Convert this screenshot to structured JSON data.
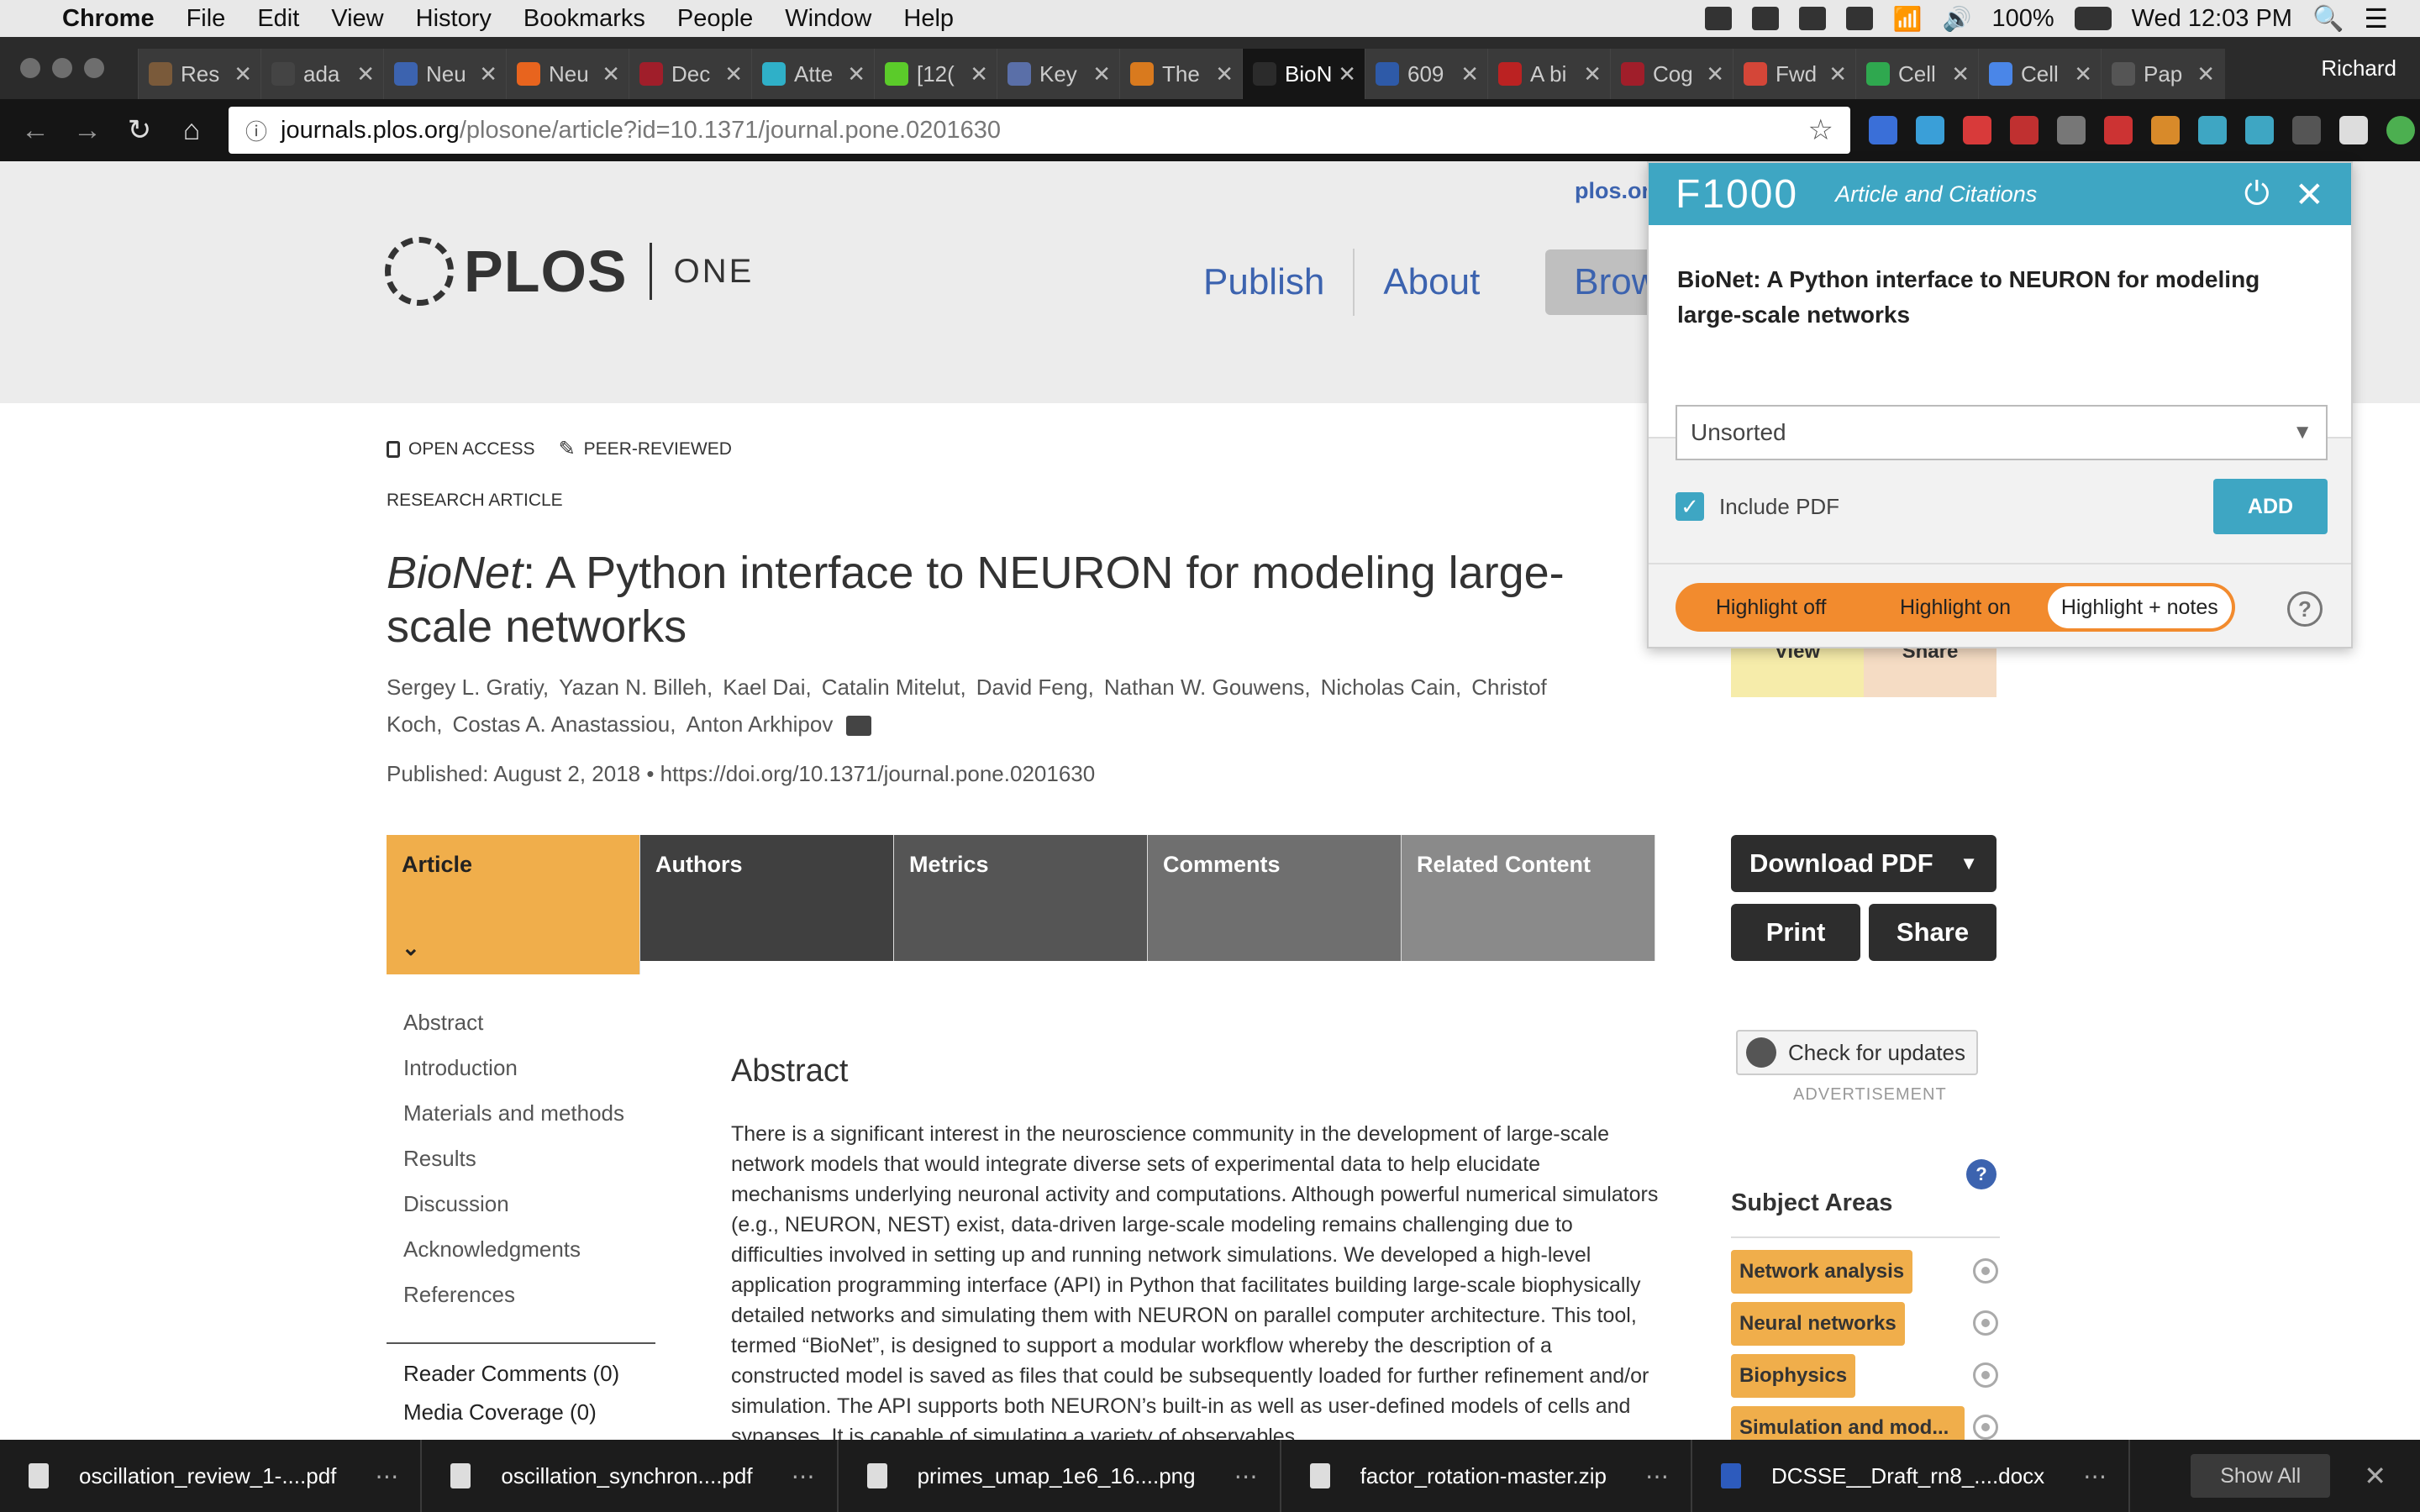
{
  "menubar": {
    "app": "Chrome",
    "items": [
      "File",
      "Edit",
      "View",
      "History",
      "Bookmarks",
      "People",
      "Window",
      "Help"
    ],
    "battery": "100%",
    "clock": "Wed 12:03 PM"
  },
  "tabs": [
    {
      "label": "Res",
      "fav": "#7a5a3a"
    },
    {
      "label": "ada",
      "fav": "#444"
    },
    {
      "label": "Neu",
      "fav": "#3c63af"
    },
    {
      "label": "Neu",
      "fav": "#e8641e"
    },
    {
      "label": "Dec",
      "fav": "#a01e2a"
    },
    {
      "label": "Atte",
      "fav": "#2fb0c8"
    },
    {
      "label": "[12(",
      "fav": "#5bcb2a"
    },
    {
      "label": "Key",
      "fav": "#5a6fa8"
    },
    {
      "label": "The",
      "fav": "#d97a1e"
    },
    {
      "label": "BioN",
      "fav": "#2b2b2b",
      "active": true
    },
    {
      "label": "609",
      "fav": "#2e5aa8"
    },
    {
      "label": "A bi",
      "fav": "#bb2222"
    },
    {
      "label": "Cog",
      "fav": "#a01e2a"
    },
    {
      "label": "Fwd",
      "fav": "#d44638"
    },
    {
      "label": "Cell",
      "fav": "#2fa84f"
    },
    {
      "label": "Cell",
      "fav": "#4a86e8"
    },
    {
      "label": "Pap",
      "fav": "#555"
    }
  ],
  "profile": "Richard",
  "omnibox": {
    "host": "journals.plos.org",
    "path": "/plosone/article?id=10.1371/journal.pone.0201630"
  },
  "plos_link": "plos.or",
  "logo": {
    "plos": "PLOS",
    "one": "ONE"
  },
  "topnav": {
    "publish": "Publish",
    "about": "About",
    "browse": "Browse"
  },
  "badges": {
    "open": "OPEN ACCESS",
    "peer": "PEER-REVIEWED"
  },
  "article_type": "RESEARCH ARTICLE",
  "title_italic": "BioNet",
  "title_rest": ": A Python interface to NEURON for modeling large-scale networks",
  "authors": [
    "Sergey L. Gratiy,",
    "Yazan N. Billeh,",
    "Kael Dai,",
    "Catalin Mitelut,",
    "David Feng,",
    "Nathan W. Gouwens,",
    "Nicholas Cain,",
    "Christof Koch,",
    "Costas A. Anastassiou,",
    "Anton Arkhipov"
  ],
  "published": "Published: August 2, 2018 •  https://doi.org/10.1371/journal.pone.0201630",
  "article_tabs": [
    "Article",
    "Authors",
    "Metrics",
    "Comments",
    "Related Content"
  ],
  "toc": [
    "Abstract",
    "Introduction",
    "Materials and methods",
    "Results",
    "Discussion",
    "Acknowledgments",
    "References"
  ],
  "toc2": [
    "Reader Comments (0)",
    "Media Coverage (0)"
  ],
  "abstract_heading": "Abstract",
  "abstract_text": "There is a significant interest in the neuroscience community in the development of large-scale network models that would integrate diverse sets of experimental data to help elucidate mechanisms underlying neuronal activity and computations. Although powerful numerical simulators (e.g., NEURON, NEST) exist, data-driven large-scale modeling remains challenging due to difficulties involved in setting up and running network simulations. We developed a high-level application programming interface (API) in Python that facilitates building large-scale biophysically detailed networks and simulating them with NEURON on parallel computer architecture. This tool, termed “BioNet”, is designed to support a modular workflow whereby the description of a constructed model is saved as files that could be subsequently loaded for further refinement and/or simulation. The API supports both NEURON’s built-in as well as user-defined models of cells and synapses. It is capable of simulating a variety of observables",
  "right": {
    "view": "View",
    "share_top": "Share",
    "download": "Download PDF",
    "print": "Print",
    "share": "Share",
    "updates": "Check for updates",
    "advert": "ADVERTISEMENT",
    "subject_heading": "Subject Areas",
    "subjects": [
      "Network analysis",
      "Neural networks",
      "Biophysics",
      "Simulation and mod..."
    ]
  },
  "f1000": {
    "logo": "F1000",
    "subtitle": "Article and Citations",
    "title": "BioNet: A Python interface to NEURON for modeling large-scale networks",
    "folder": "Unsorted",
    "include_pdf": "Include PDF",
    "add": "ADD",
    "highlight": [
      "Highlight off",
      "Highlight on",
      "Highlight + notes"
    ]
  },
  "downloads": [
    {
      "name": "oscillation_review_1-....pdf",
      "type": "pdf"
    },
    {
      "name": "oscillation_synchron....pdf",
      "type": "pdf"
    },
    {
      "name": "primes_umap_1e6_16....png",
      "type": "png"
    },
    {
      "name": "factor_rotation-master.zip",
      "type": "zip"
    },
    {
      "name": "DCSSE__Draft_rn8_....docx",
      "type": "docx"
    }
  ],
  "show_all": "Show All"
}
